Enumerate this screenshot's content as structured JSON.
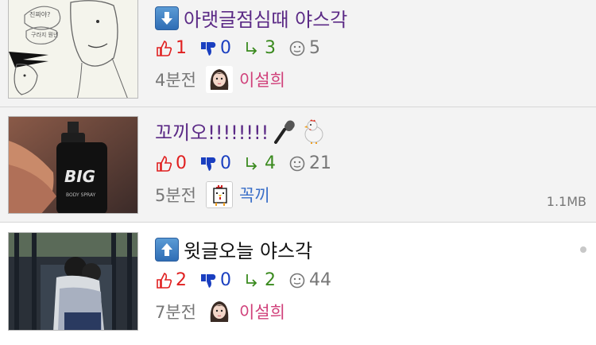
{
  "posts": [
    {
      "title": "아랫글점심때 야스각",
      "title_icon": "down-arrow-icon",
      "likes": "1",
      "dislikes": "0",
      "replies": "3",
      "views": "5",
      "time": "4분전",
      "author": "이설희",
      "avatar": "girl-avatar-icon"
    },
    {
      "title": "꼬끼오!!!!!!!!",
      "title_emojis": [
        "🎤",
        "🐔"
      ],
      "likes": "0",
      "dislikes": "0",
      "replies": "4",
      "views": "21",
      "time": "5분전",
      "author": "꼭끼",
      "avatar": "chicken-avatar-icon",
      "size": "1.1MB"
    },
    {
      "title": "윗글오늘 야스각",
      "title_icon": "up-arrow-icon",
      "likes": "2",
      "dislikes": "0",
      "replies": "2",
      "views": "44",
      "time": "7분전",
      "author": "이설희",
      "avatar": "girl-avatar-icon"
    }
  ],
  "colors": {
    "like": "#e02020",
    "dislike": "#1a3fc0",
    "reply": "#3a8a1e",
    "author_female": "#d0407a",
    "author_male": "#3a6fc8",
    "read_title": "#5b2a86"
  }
}
